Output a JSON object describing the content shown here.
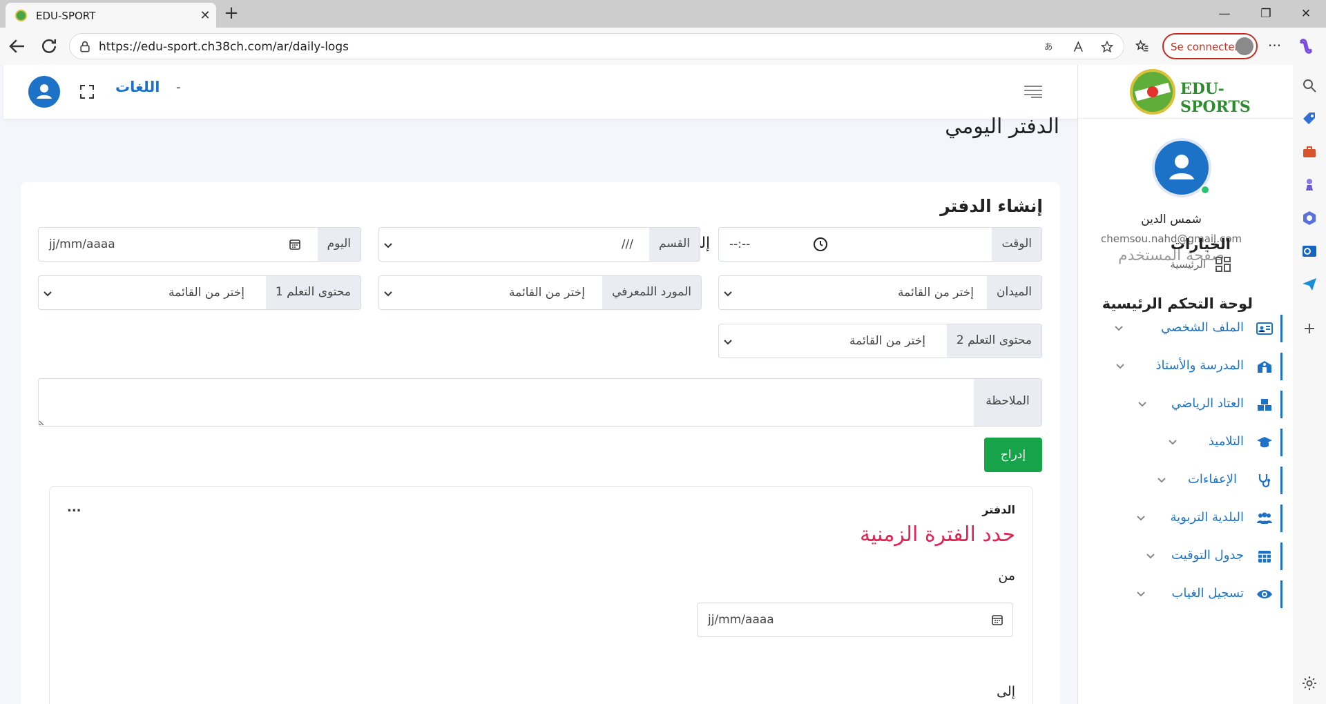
{
  "browser": {
    "tab_title": "EDU-SPORT",
    "url": "https://edu-sport.ch38ch.com/ar/daily-logs",
    "signin_label": "Se connecter"
  },
  "topbar": {
    "languages": "اللغات",
    "dash": "-"
  },
  "sidebar": {
    "logo_text": "EDU-SPORTS",
    "user_name": "شمس الدين",
    "user_email": "chemsou.nahd@gmail.com",
    "profile_link": "صفحة المستخدم",
    "options_heading": "الخيارات",
    "home_label": "الرئيسية",
    "dashboard_heading": "لوحة التحكم الرئيسية",
    "items": [
      {
        "label": "الملف الشخصي",
        "icon": "id-card-icon"
      },
      {
        "label": "المدرسة والأستاذ",
        "icon": "school-icon"
      },
      {
        "label": "العتاد الرياضي",
        "icon": "equipment-icon"
      },
      {
        "label": "التلاميذ",
        "icon": "graduation-cap-icon"
      },
      {
        "label": "الإعفاءات",
        "icon": "stethoscope-icon"
      },
      {
        "label": "البلدية التربوية",
        "icon": "users-icon"
      },
      {
        "label": "جدول التوقيت",
        "icon": "calendar-icon"
      },
      {
        "label": "تسجيل الغياب",
        "icon": "eye-icon"
      }
    ]
  },
  "page": {
    "title": "الدفتر اليومي",
    "card_title": "إنشاء الدفتر"
  },
  "form": {
    "time_label": "الوقت",
    "time_from": "--:--",
    "to_label": "إلى",
    "time_to": "--:--",
    "section_label": "القسم",
    "section_value": "///",
    "day_label": "اليوم",
    "date_placeholder": "jj/mm/aaaa",
    "field_label": "الميدان",
    "resource_label": "المورد اللمعرفي",
    "content1_label": "محتوى التعلم 1",
    "content2_label": "محتوى التعلم 2",
    "select_placeholder": "إختر من القائمة",
    "note_label": "الملاحظة",
    "submit_label": "إدراج"
  },
  "logbook": {
    "title": "الدفتر",
    "menu": "...",
    "period_title": "حدد الفترة الزمنية",
    "from_label": "من",
    "date_placeholder": "jj/mm/aaaa",
    "to_label": "إلى"
  },
  "colors": {
    "accent": "#1b72c7",
    "submit": "#16a34a",
    "period": "#e02454"
  }
}
